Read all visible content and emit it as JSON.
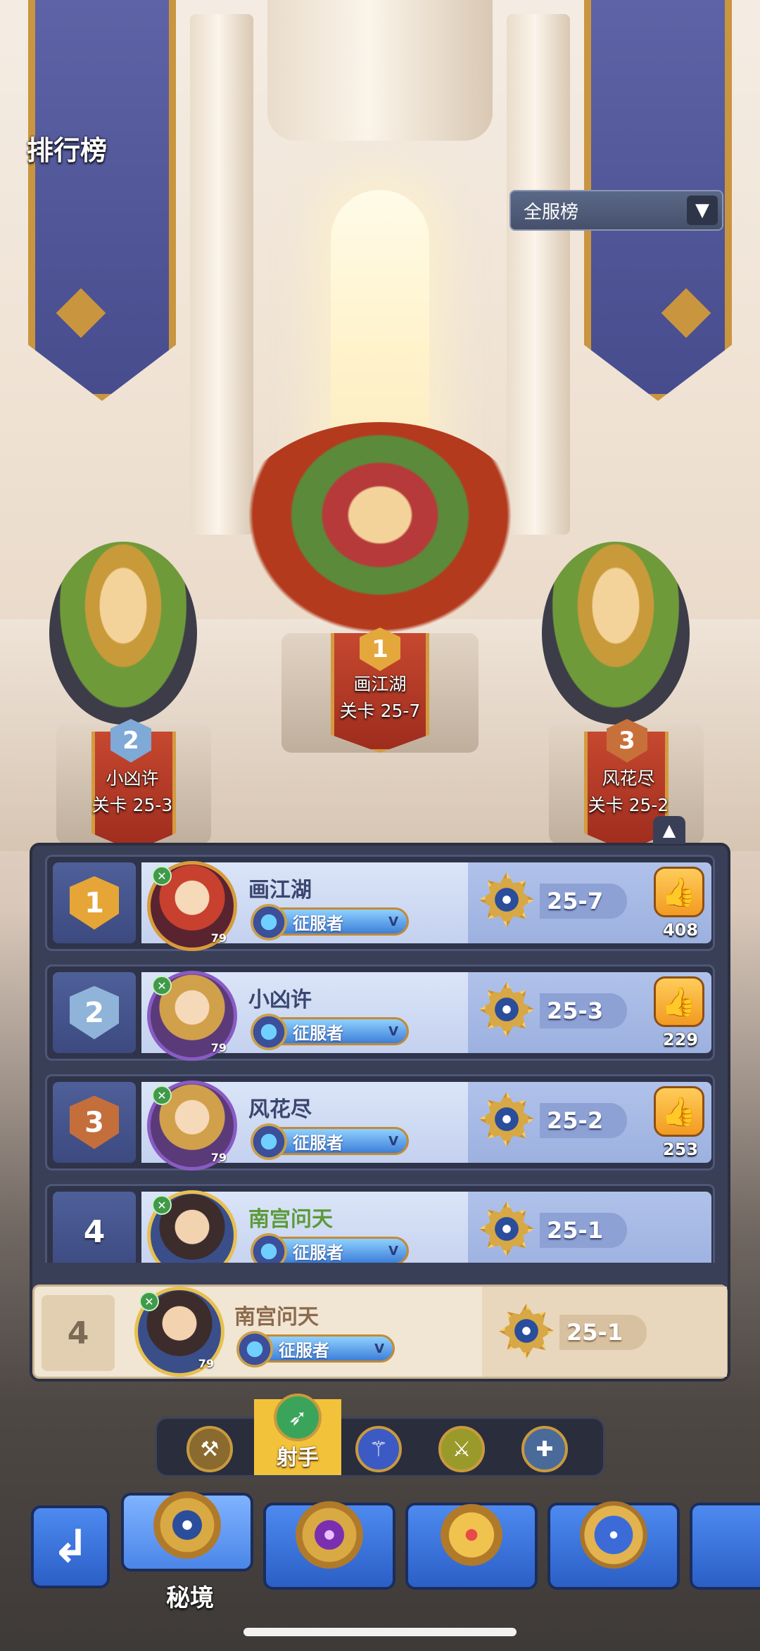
{
  "header": {
    "title": "排行榜"
  },
  "filter": {
    "selected": "全服榜",
    "arrow_icon": "chevron-down-icon"
  },
  "podium": [
    {
      "rank": "1",
      "name": "画江湖",
      "stage": "关卡 25-7"
    },
    {
      "rank": "2",
      "name": "小凶许",
      "stage": "关卡 25-3"
    },
    {
      "rank": "3",
      "name": "风花尽",
      "stage": "关卡 25-2"
    }
  ],
  "collapse_icon": "▲",
  "rows": [
    {
      "rank": "1",
      "name": "画江湖",
      "level": "79",
      "title": "征服者",
      "title_tier": "V",
      "stage": "25-7",
      "likes": "408"
    },
    {
      "rank": "2",
      "name": "小凶许",
      "level": "79",
      "title": "征服者",
      "title_tier": "V",
      "stage": "25-3",
      "likes": "229"
    },
    {
      "rank": "3",
      "name": "风花尽",
      "level": "79",
      "title": "征服者",
      "title_tier": "V",
      "stage": "25-2",
      "likes": "253"
    },
    {
      "rank": "4",
      "name": "南宫问天",
      "level": "79",
      "title": "征服者",
      "title_tier": "V",
      "stage": "25-1"
    }
  ],
  "my_row": {
    "rank": "4",
    "name": "南宫问天",
    "level": "79",
    "title": "征服者",
    "title_tier": "V",
    "stage": "25-1"
  },
  "class_tabs": {
    "selected_label": "射手",
    "icons": [
      "warrior-axe-icon",
      "archer-bow-icon",
      "mage-staff-icon",
      "assassin-blade-icon",
      "priest-cross-icon"
    ]
  },
  "modes": [
    {
      "label": "秘境",
      "icon": "secret-realm-emblem-icon"
    },
    {
      "icon": "purple-gem-emblem-icon"
    },
    {
      "icon": "crown-emblem-icon"
    },
    {
      "icon": "star-emblem-icon"
    }
  ],
  "colors": {
    "accent": "#f2c23a",
    "panel": "#3a3f58",
    "row_highlight": "#dbe5f8",
    "self_row": "#f1e6d3"
  }
}
